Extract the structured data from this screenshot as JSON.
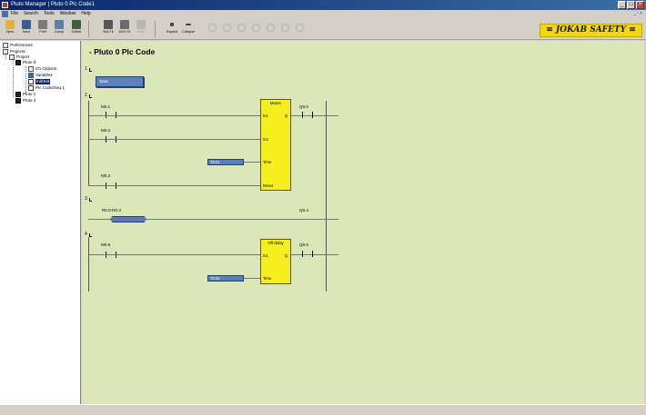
{
  "window": {
    "title": "Pluto Manager  |  Pluto 0 Plc Code1",
    "buttons": [
      "_",
      "□",
      "×"
    ]
  },
  "menu": {
    "items": [
      "File",
      "Search",
      "Tools",
      "Window",
      "Help"
    ],
    "mdi_controls": "_ ▫ ×"
  },
  "toolbar": {
    "buttons": [
      {
        "label": "Open",
        "icon": "open-folder-icon"
      },
      {
        "label": "Save",
        "icon": "save-disk-icon"
      },
      {
        "label": "Print",
        "icon": "printer-icon"
      },
      {
        "label": "Compi",
        "icon": "compile-icon"
      },
      {
        "label": "Online",
        "icon": "online-icon"
      },
      {
        "label": "Bus Tk",
        "icon": "bus-icon"
      },
      {
        "label": "All In Tk",
        "icon": "all-in-icon"
      },
      {
        "label": "Undo",
        "icon": "undo-icon"
      },
      {
        "label": "Expand",
        "icon": "expand-icon"
      },
      {
        "label": "Collapse",
        "icon": "collapse-icon"
      }
    ],
    "brand": "JOKAB SAFETY"
  },
  "tree": {
    "items": [
      {
        "label": "Preferences",
        "icon": "preferences-icon"
      },
      {
        "label": "Projects",
        "icon": "projects-icon"
      },
      {
        "label": "Project",
        "icon": "project-icon"
      },
      {
        "label": "Pluto 0",
        "icon": "plc-icon"
      },
      {
        "label": "I/O Options",
        "icon": "io-icon"
      },
      {
        "label": "Variables",
        "icon": "variables-icon"
      },
      {
        "label": "Init/Set",
        "icon": "diagram-icon",
        "selected": true
      },
      {
        "label": "Plc Code/Seq 1",
        "icon": "diagram-icon"
      },
      {
        "label": "Pluto 1",
        "icon": "plc-icon"
      },
      {
        "label": "Pluto 2",
        "icon": "plc-icon"
      }
    ]
  },
  "code": {
    "title": "- Pluto 0 Plc Code",
    "networks": [
      "1",
      "2",
      "3",
      "4"
    ],
    "start_label": "Start",
    "n2": {
      "contacts": [
        "M0.1",
        "M0.2",
        "M0.3"
      ],
      "output": "Q0.0",
      "block_title": "Mute1",
      "pins_left": [
        "In1",
        "In2",
        "Time",
        "Reset"
      ],
      "pin_right": "Q",
      "timer_var": "T0.01"
    },
    "n3": {
      "contact": "R0.0-R0.3",
      "output": "Q0.4"
    },
    "n4": {
      "contact": "M0.5",
      "output": "Q0.5",
      "block_title": "Off delay",
      "pins_left": [
        "In1",
        "Time"
      ],
      "pin_right": "Q",
      "timer_var": "T0.02"
    }
  }
}
